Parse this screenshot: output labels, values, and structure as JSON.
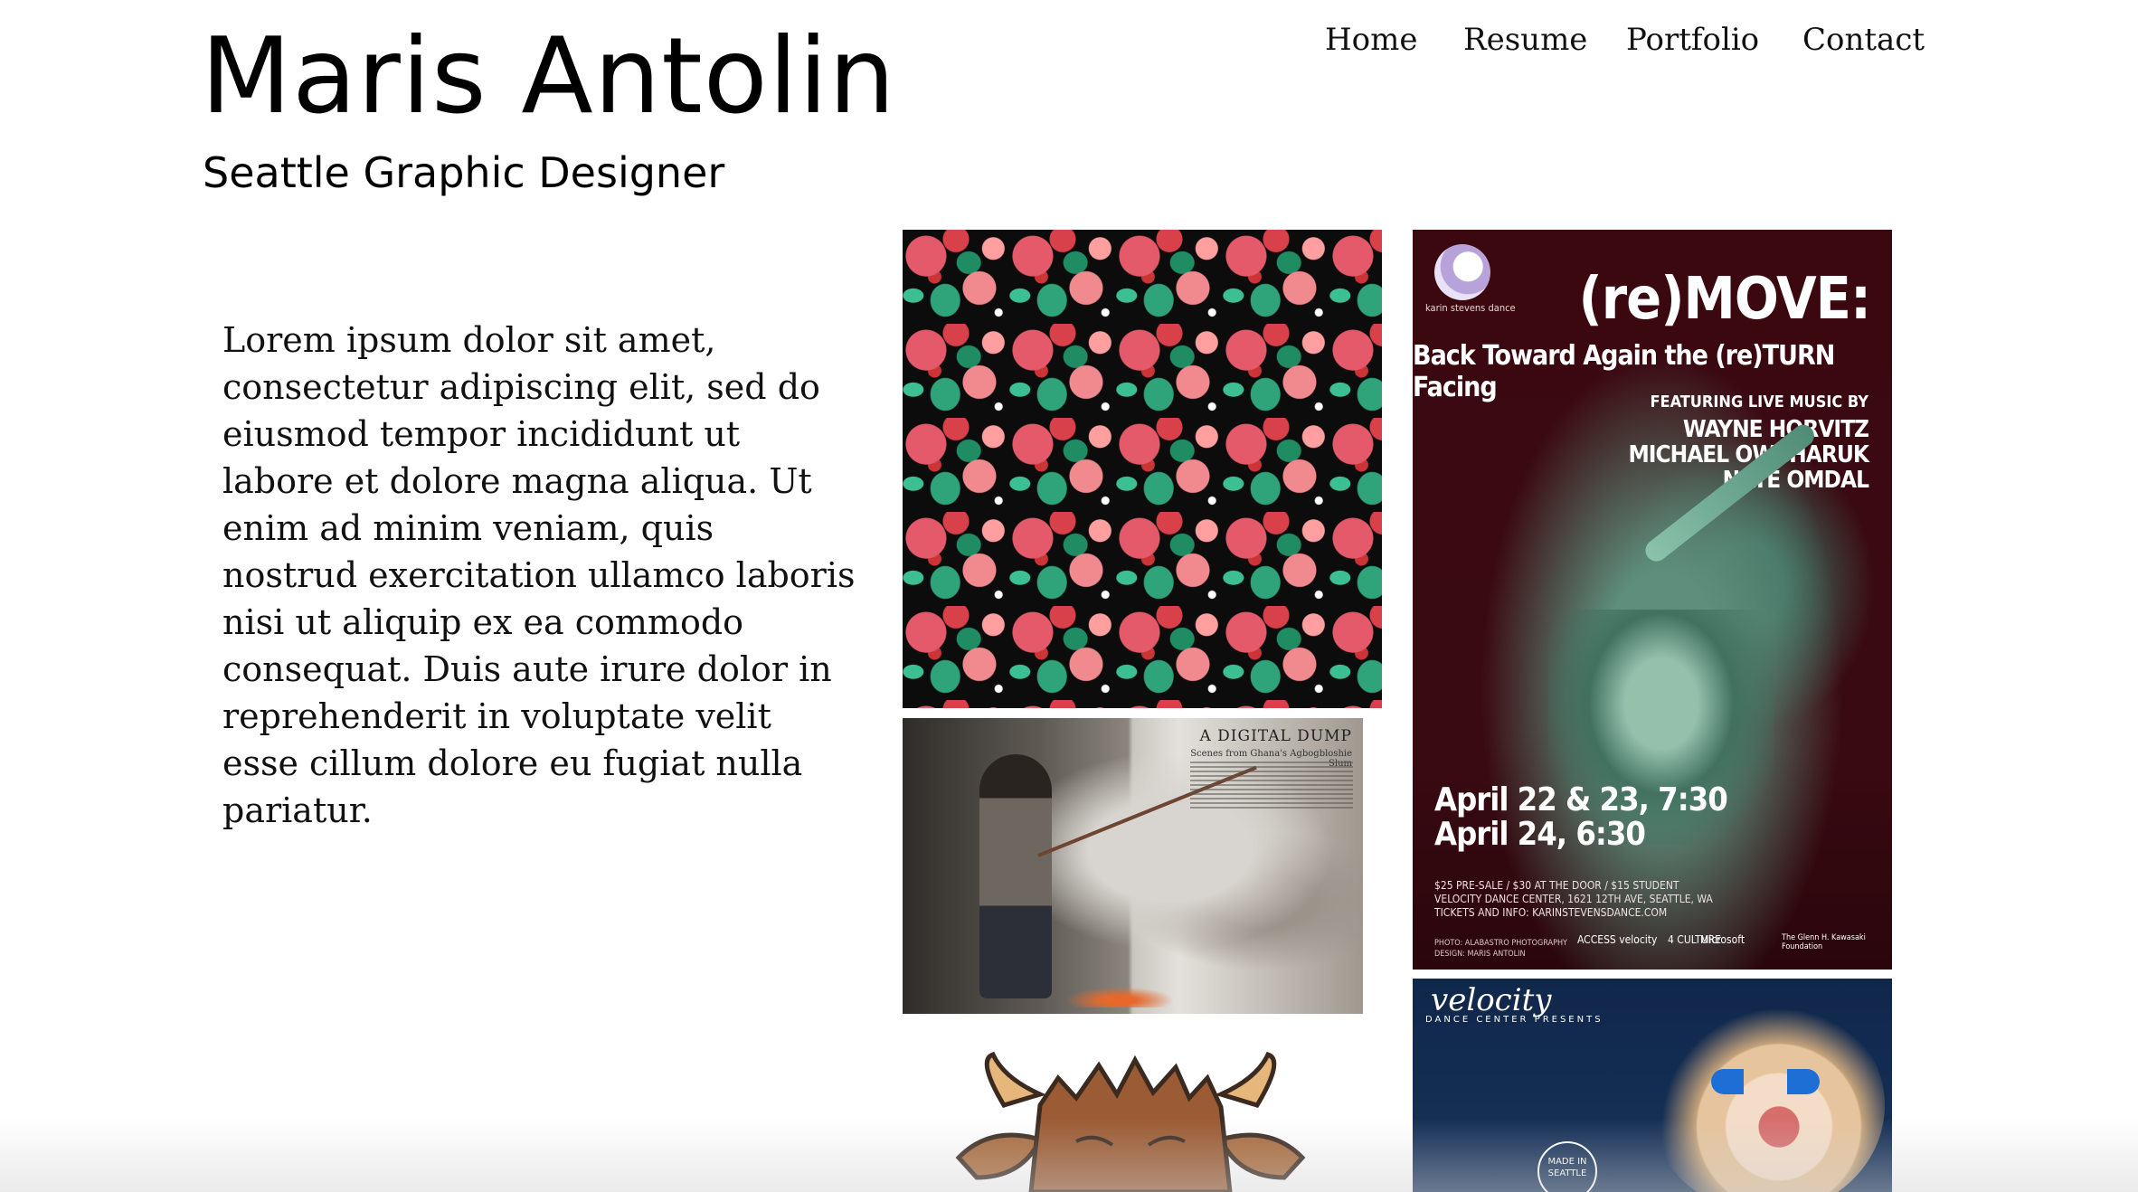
{
  "header": {
    "site_title": "Maris Antolin",
    "tagline": "Seattle Graphic Designer"
  },
  "nav": {
    "items": [
      {
        "label": "Home"
      },
      {
        "label": "Resume"
      },
      {
        "label": "Portfolio"
      },
      {
        "label": "Contact"
      }
    ]
  },
  "intro": {
    "text": "Lorem ipsum dolor sit amet, consectetur adipiscing elit, sed do eiusmod tempor incididunt ut labore et dolore magna aliqua. Ut enim ad minim veniam, quis nostrud exercitation ullamco laboris nisi ut aliquip ex ea commodo consequat. Duis aute irure dolor in reprehenderit in voluptate velit esse cillum dolore eu fugiat nulla pariatur."
  },
  "portfolio": {
    "magazine": {
      "headline": "A DIGITAL DUMP",
      "subhead": "Scenes from Ghana's Agbogbloshie Slum"
    },
    "poster": {
      "org": "karin stevens dance",
      "title": "(re)MOVE:",
      "subtitle": "Back Toward Again the (re)TURN Facing",
      "featuring": "FEATURING LIVE MUSIC BY",
      "musicians": [
        "WAYNE HORVITZ",
        "MICHAEL OWCHARUK",
        "NATE OMDAL"
      ],
      "dates": [
        "April 22 & 23, 7:30",
        "April 24, 6:30"
      ],
      "info": [
        "$25 PRE-SALE / $30 AT THE DOOR / $15 STUDENT",
        "VELOCITY DANCE CENTER, 1621 12TH AVE, SEATTLE, WA",
        "TICKETS AND INFO: KARINSTEVENSDANCE.COM"
      ],
      "credits": [
        "PHOTO: ALABASTRO PHOTOGRAPHY",
        "DESIGN: MARIS ANTOLIN"
      ],
      "sponsors": [
        "ACCESS velocity",
        "4 CULTURE",
        "Microsoft",
        "The Glenn H. Kawasaki Foundation"
      ]
    },
    "velocity": {
      "logo": "velocity",
      "sub": "DANCE CENTER PRESENTS",
      "badge_line1": "MADE IN",
      "badge_line2": "SEATTLE"
    }
  }
}
